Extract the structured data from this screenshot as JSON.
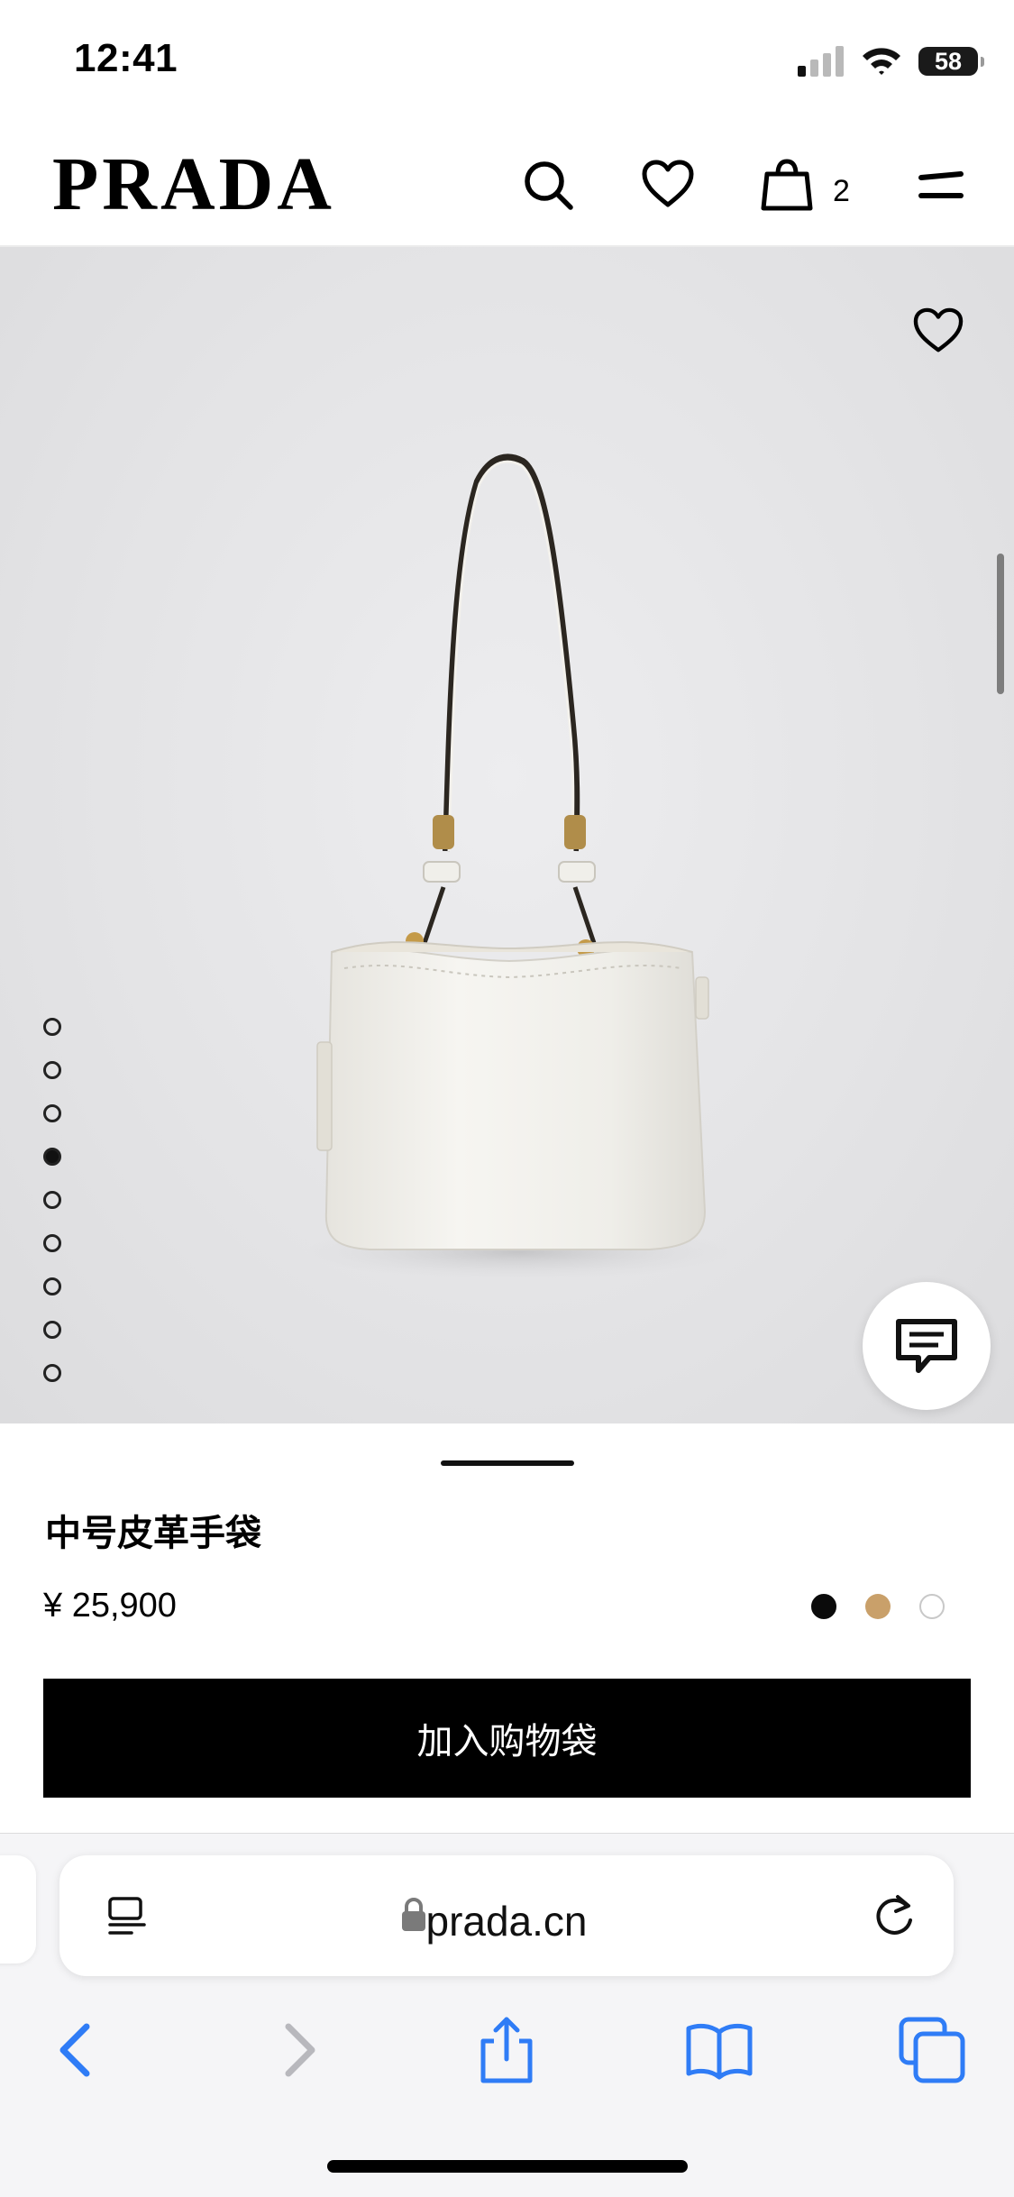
{
  "status_bar": {
    "time": "12:41",
    "battery": "58"
  },
  "header": {
    "brand": "PRADA",
    "cart_count": "2"
  },
  "product": {
    "name": "中号皮革手袋",
    "price": "¥ 25,900",
    "add_to_bag_label": "加入购物袋",
    "image_count": 9,
    "active_image_index": 3,
    "colors": [
      "#0b0b0b",
      "#c9a06a",
      "#ffffff"
    ],
    "selected_color": "#0b0b0b"
  },
  "browser": {
    "url": "prada.cn"
  },
  "icons": {
    "header": [
      "search-icon",
      "heart-icon",
      "shopping-bag-icon",
      "menu-icon"
    ],
    "toolbar": [
      "back-icon",
      "forward-icon",
      "share-icon",
      "bookmarks-icon",
      "tabs-icon"
    ]
  }
}
